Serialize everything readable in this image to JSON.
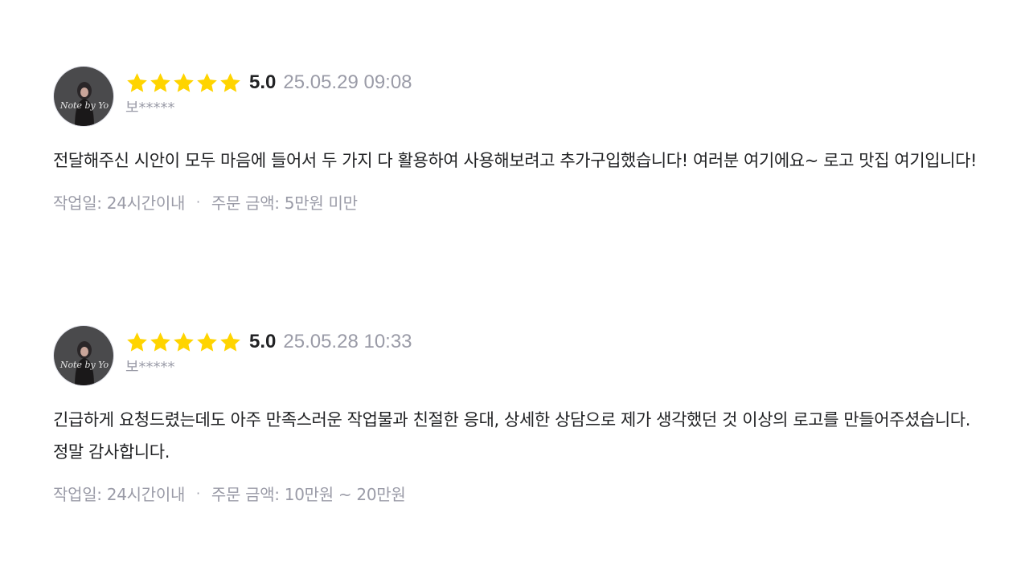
{
  "colors": {
    "star": "#ffd400",
    "muted": "#9a9ba7",
    "text": "#212224"
  },
  "reviews": [
    {
      "rating_stars": 5,
      "score": "5.0",
      "date": "25.05.29 09:08",
      "nickname": "보*****",
      "avatar_text": "Note by Yo",
      "body": "전달해주신 시안이 모두 마음에 들어서 두 가지 다 활용하여 사용해보려고 추가구입했습니다! 여러분 여기에요~ 로고 맛집 여기입니다!",
      "work_period": "작업일: 24시간이내",
      "separator": "·",
      "order_amount": "주문 금액: 5만원 미만"
    },
    {
      "rating_stars": 5,
      "score": "5.0",
      "date": "25.05.28 10:33",
      "nickname": "보*****",
      "avatar_text": "Note by Yo",
      "body": "긴급하게 요청드렸는데도 아주 만족스러운 작업물과 친절한 응대, 상세한 상담으로 제가 생각했던 것 이상의 로고를 만들어주셨습니다. 정말 감사합니다.",
      "work_period": "작업일: 24시간이내",
      "separator": "·",
      "order_amount": "주문 금액: 10만원 ~ 20만원"
    }
  ]
}
